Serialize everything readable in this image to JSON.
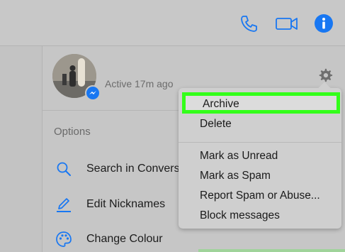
{
  "header": {
    "icons": [
      "phone-icon",
      "video-camera-icon",
      "info-icon"
    ],
    "accent_color": "#1877f2"
  },
  "profile": {
    "status": "Active 17m ago"
  },
  "options": {
    "heading": "Options",
    "items": [
      {
        "label": "Search in Convers",
        "icon": "search-icon"
      },
      {
        "label": "Edit Nicknames",
        "icon": "pencil-icon"
      },
      {
        "label": "Change Colour",
        "icon": "palette-icon"
      }
    ]
  },
  "menu": {
    "items": [
      {
        "label": "Archive",
        "highlighted": true
      },
      {
        "label": "Delete"
      },
      {
        "label": "Mark as Unread"
      },
      {
        "label": "Mark as Spam"
      },
      {
        "label": "Report Spam or Abuse..."
      },
      {
        "label": "Block messages"
      }
    ],
    "highlight_color": "#33ff1a"
  }
}
